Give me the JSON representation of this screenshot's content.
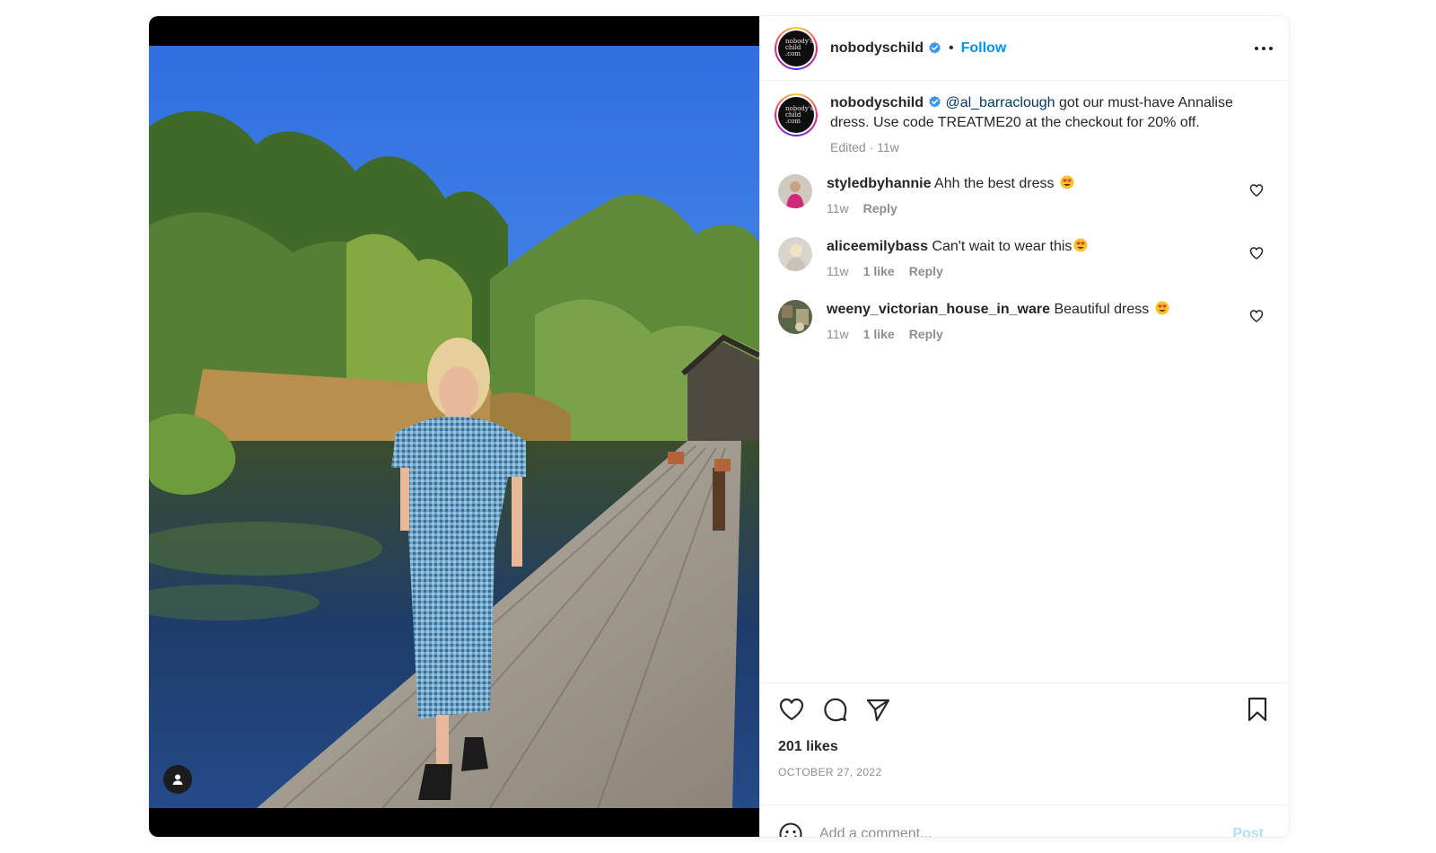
{
  "colors": {
    "accent": "#0095f6",
    "post_disabled": "#b2dffc",
    "text": "#262626",
    "muted": "#8e8e8e",
    "mention": "#00376b",
    "verified": "#3897f0"
  },
  "photo": {
    "tag_icon": "person-tag-icon"
  },
  "header": {
    "username": "nobodyschild",
    "separator": "•",
    "follow_label": "Follow",
    "avatar_text": [
      "nobody's",
      "child",
      ".com"
    ],
    "more_icon": "more-options-icon"
  },
  "caption": {
    "username": "nobodyschild",
    "mention": "@al_barraclough",
    "text": " got our must-have Annalise dress. Use code TREATME20 at the checkout for 20% off.",
    "meta": "Edited · 11w"
  },
  "comments": [
    {
      "username": "styledbyhannie",
      "text": " Ahh the best dress ",
      "emoji": "heart-eyes-emoji",
      "time": "11w",
      "likes": "",
      "reply": "Reply"
    },
    {
      "username": "aliceemilybass",
      "text": " Can't wait to wear this",
      "emoji": "heart-eyes-emoji",
      "time": "11w",
      "likes": "1 like",
      "reply": "Reply"
    },
    {
      "username": "weeny_victorian_house_in_ware",
      "text": " Beautiful dress ",
      "emoji": "heart-eyes-emoji",
      "time": "11w",
      "likes": "1 like",
      "reply": "Reply"
    }
  ],
  "actions": {
    "icons": [
      "heart-icon",
      "comment-icon",
      "share-icon",
      "bookmark-icon"
    ],
    "likes": "201 likes",
    "date": "OCTOBER 27, 2022"
  },
  "add_comment": {
    "placeholder": "Add a comment...",
    "post_label": "Post"
  }
}
